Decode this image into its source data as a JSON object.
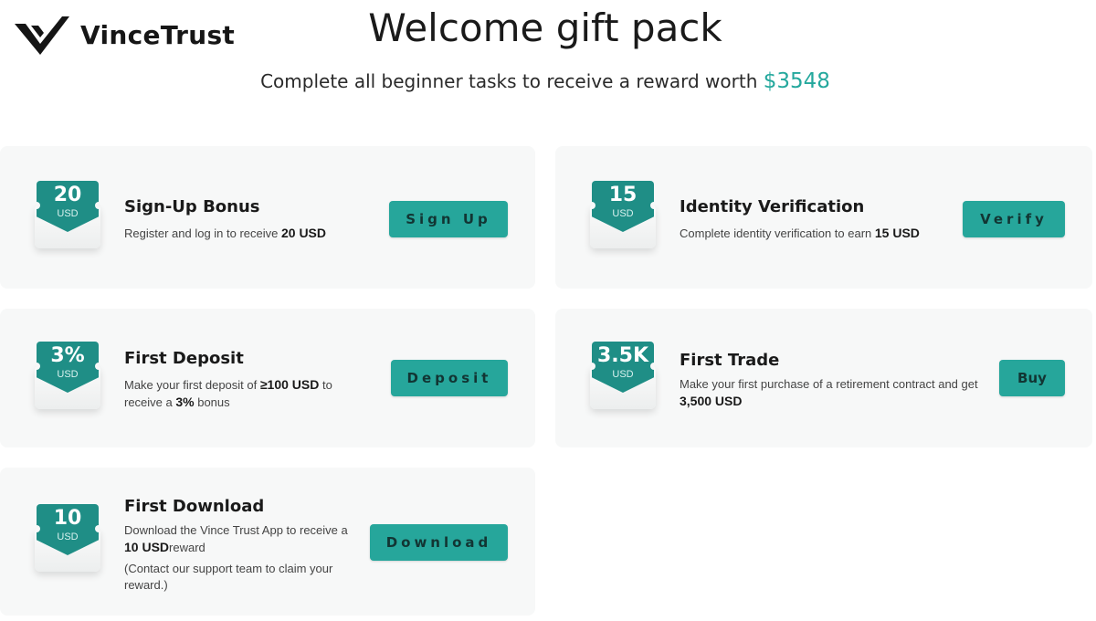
{
  "brand": {
    "name": "VinceTrust"
  },
  "header": {
    "title": "Welcome gift pack",
    "subtitle": "Complete all beginner tasks to receive a reward worth",
    "reward_amount": "$3548"
  },
  "colors": {
    "accent": "#26a69b",
    "badge": "#1f8e86",
    "card_bg": "#f7f8f8"
  },
  "tasks": [
    {
      "badge_value": "20",
      "badge_unit": "USD",
      "title": "Sign-Up Bonus",
      "desc_pre": "Register and log in to receive ",
      "desc_bold": "20 USD",
      "desc_post": "",
      "button": "Sign Up"
    },
    {
      "badge_value": "15",
      "badge_unit": "USD",
      "title": "Identity Verification",
      "desc_pre": "Complete identity verification to earn ",
      "desc_bold": "15 USD",
      "desc_post": "",
      "button": "Verify"
    },
    {
      "badge_value": "3%",
      "badge_unit": "USD",
      "title": "First Deposit",
      "desc_pre": "Make your first deposit of ",
      "desc_bold": "≥100 USD",
      "desc_mid": " to receive a ",
      "desc_bold2": "3%",
      "desc_post": " bonus",
      "button": "Deposit"
    },
    {
      "badge_value": "3.5K",
      "badge_unit": "USD",
      "title": "First Trade",
      "desc_pre": "Make your first purchase of a retirement contract and get ",
      "desc_bold": "3,500 USD",
      "desc_post": "",
      "button": "Buy"
    },
    {
      "badge_value": "10",
      "badge_unit": "USD",
      "title": "First Download",
      "desc_pre": "Download the Vince Trust App to receive a ",
      "desc_bold": "10 USD",
      "desc_post": "reward",
      "note": "(Contact our support team to claim your reward.)",
      "button": "Download"
    }
  ]
}
